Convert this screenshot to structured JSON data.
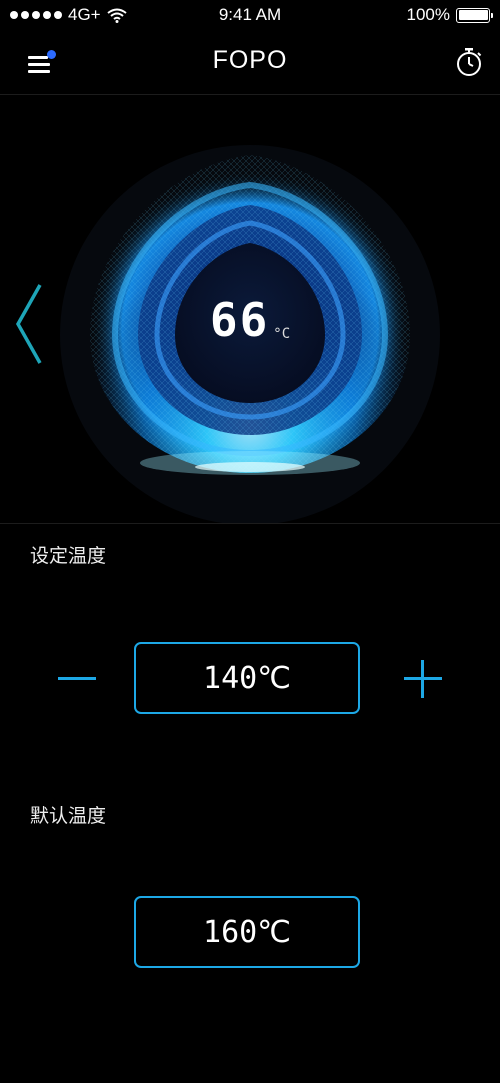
{
  "status_bar": {
    "carrier": "4G+",
    "time": "9:41 AM",
    "battery": "100%"
  },
  "nav": {
    "title": "FOPO",
    "menu_icon": "hamburger-menu-icon",
    "timer_icon": "stopwatch-icon",
    "notification_dot_color": "#2c6bff"
  },
  "hero": {
    "current_temperature": "66",
    "unit": "°C",
    "prev_icon": "chevron-left-icon"
  },
  "set_temperature": {
    "label": "设定温度",
    "value": "140℃",
    "decrease_icon": "minus-icon",
    "increase_icon": "plus-icon"
  },
  "default_temperature": {
    "label": "默认温度",
    "value": "160℃"
  },
  "colors": {
    "background": "#000000",
    "accent": "#1da8e6",
    "glow": "#0aa6ff"
  }
}
